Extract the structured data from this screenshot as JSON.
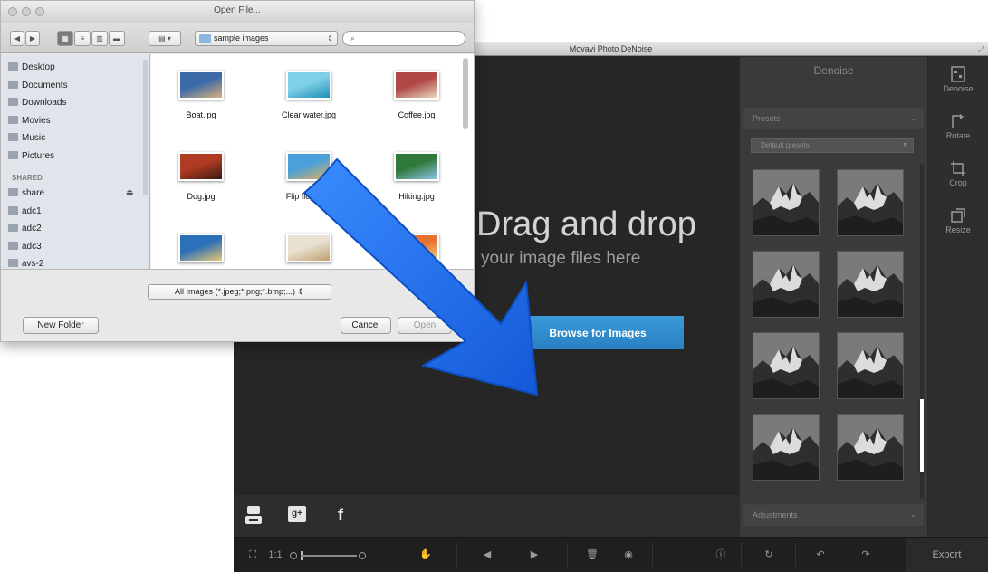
{
  "movavi": {
    "window_title": "Movavi Photo DeNoise",
    "drag_title": "Drag and drop",
    "drag_subtitle": "your image files here",
    "browse_label": "Browse for Images",
    "panel_title": "Denoise",
    "presets_section": "Presets",
    "presets_dropdown": "Default presets",
    "adjustments_section": "Adjustments",
    "right_tools": [
      {
        "label": "Denoise",
        "icon": "denoise-icon"
      },
      {
        "label": "Rotate",
        "icon": "rotate-icon"
      },
      {
        "label": "Crop",
        "icon": "crop-icon"
      },
      {
        "label": "Resize",
        "icon": "resize-icon"
      }
    ],
    "social": [
      {
        "icon": "youtube-icon",
        "glyph": "▶"
      },
      {
        "icon": "google-plus-icon",
        "glyph": "g+"
      },
      {
        "icon": "facebook-icon",
        "glyph": "f"
      }
    ],
    "bottom": {
      "zoom_label": "1:1",
      "export_label": "Export"
    }
  },
  "dialog": {
    "title": "Open File...",
    "location": "sample images",
    "search_placeholder": "",
    "sidebar_places": [
      "Desktop",
      "Documents",
      "Downloads",
      "Movies",
      "Music",
      "Pictures"
    ],
    "shared_heading": "SHARED",
    "sidebar_shared": [
      "share",
      "adc1",
      "adc2",
      "adc3",
      "avs-2"
    ],
    "files": [
      {
        "name": "Boat.jpg",
        "c1": "#3b6aa8",
        "c2": "#d7b07a"
      },
      {
        "name": "Clear water.jpg",
        "c1": "#7fd0e6",
        "c2": "#1f8fb8"
      },
      {
        "name": "Coffee.jpg",
        "c1": "#b04848",
        "c2": "#e8d8c0"
      },
      {
        "name": "Dog.jpg",
        "c1": "#b03a22",
        "c2": "#3a1a10"
      },
      {
        "name": "Flip flops.jpg",
        "c1": "#4aa0d8",
        "c2": "#e0b060"
      },
      {
        "name": "Hiking.jpg",
        "c1": "#2f7a3a",
        "c2": "#8fc4e8"
      },
      {
        "name": "",
        "c1": "#2b70b8",
        "c2": "#e8c870"
      },
      {
        "name": "",
        "c1": "#e8e0d0",
        "c2": "#c0a070"
      },
      {
        "name": "",
        "c1": "#e87030",
        "c2": "#f0d080"
      }
    ],
    "filter": "All Images (*.jpeg;*.png;*.bmp;...)",
    "new_folder": "New Folder",
    "cancel": "Cancel",
    "open": "Open"
  },
  "colors": {
    "accent_blue": "#2a80c2",
    "arrow_blue": "#1e6ff0"
  }
}
